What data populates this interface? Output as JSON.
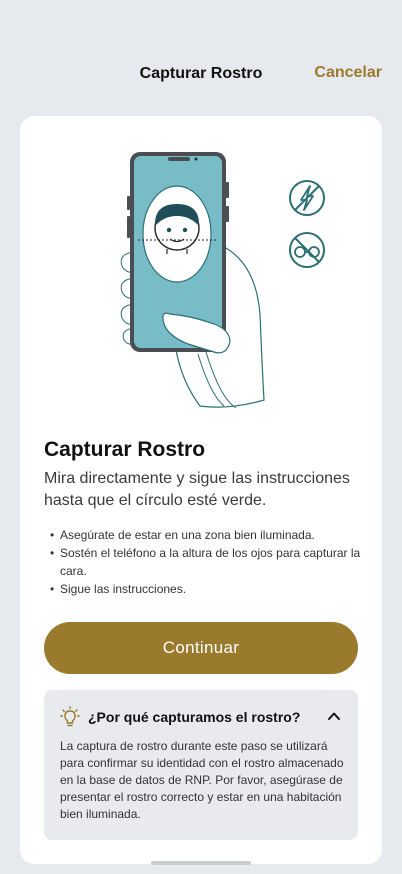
{
  "header": {
    "title": "Capturar Rostro",
    "cancel_label": "Cancelar"
  },
  "illustration": {
    "icons": [
      "no-flash-icon",
      "no-glasses-icon"
    ]
  },
  "content": {
    "title": "Capturar Rostro",
    "subtitle": "Mira directamente y sigue las instrucciones hasta que el círculo esté verde.",
    "bullets": [
      "Asegúrate de estar en una zona bien iluminada.",
      "Sostén el teléfono a la altura de los ojos para capturar la cara.",
      "Sigue las instrucciones."
    ]
  },
  "continue_label": "Continuar",
  "why": {
    "title": "¿Por qué capturamos el rostro?",
    "text": "La captura de rostro durante este paso se utilizará para confirmar su identidad con el rostro almacenado en la base de datos de RNP. Por favor, asegúrase de presentar el rostro correcto y estar en una habitación bien iluminada.",
    "expanded": true
  },
  "colors": {
    "accent": "#9a7a2c",
    "background": "#e6e9ee",
    "card": "#ffffff",
    "illustration_teal": "#78bcc8",
    "outline": "#2c6e74"
  }
}
